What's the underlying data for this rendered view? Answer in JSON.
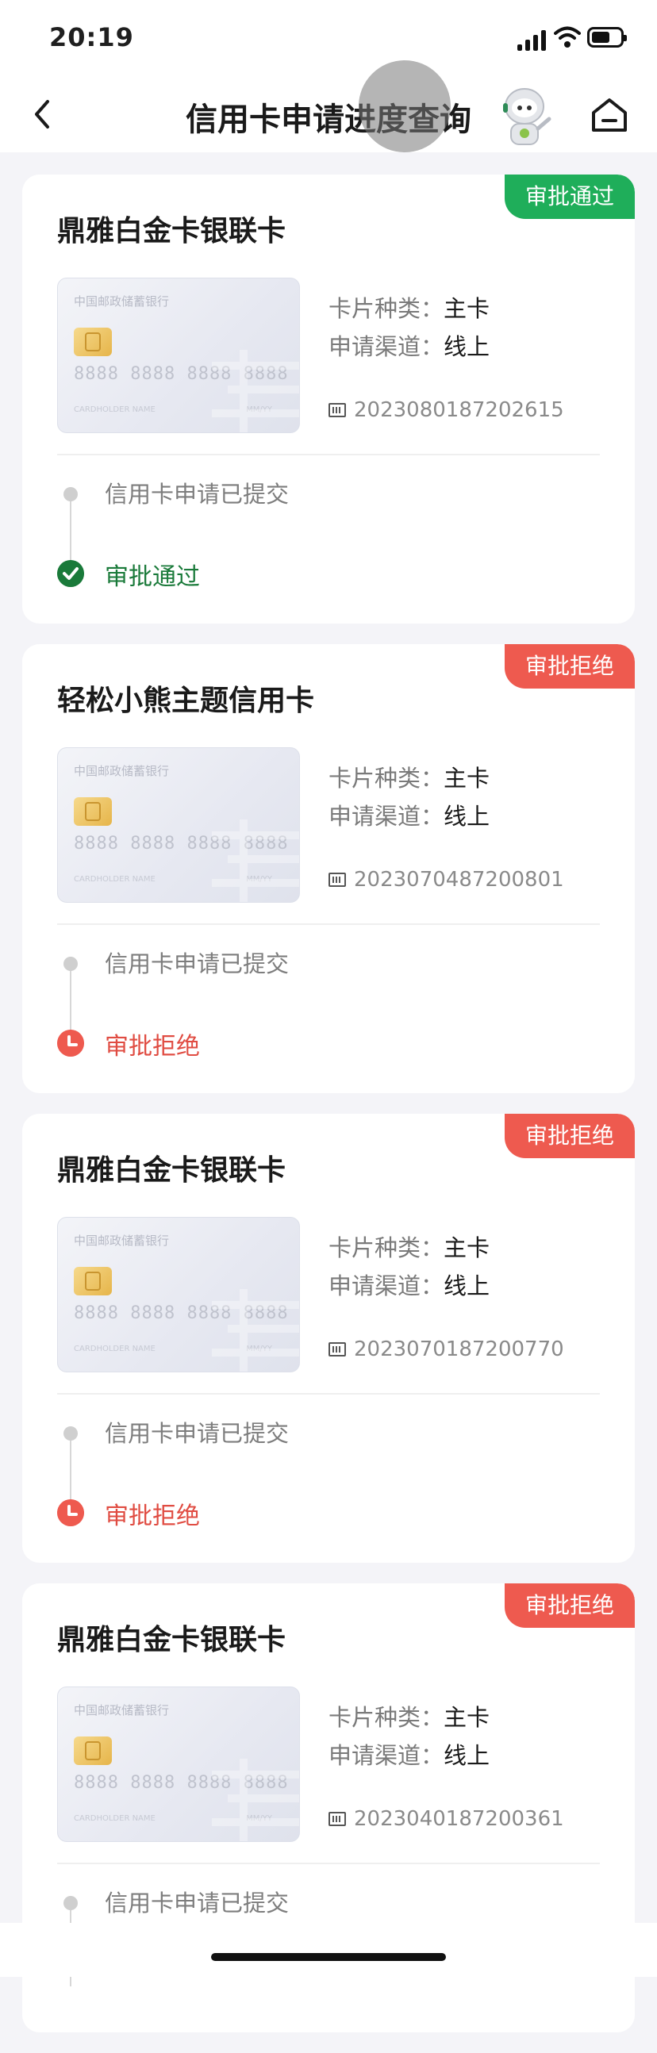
{
  "status_bar": {
    "time": "20:19"
  },
  "nav": {
    "title": "信用卡申请进度查询"
  },
  "labels": {
    "card_type_label": "卡片种类：",
    "channel_label": "申请渠道：",
    "step_submitted": "信用卡申请已提交"
  },
  "card_face": {
    "bank_name": "中国邮政储蓄银行",
    "number": "8888 8888 8888 8888",
    "holder": "CARDHOLDER NAME",
    "valid": "MM/YY"
  },
  "cards": [
    {
      "name": "鼎雅白金卡银联卡",
      "status": "审批通过",
      "status_type": "approved",
      "card_type": "主卡",
      "channel": "线上",
      "serial": "2023080187202615",
      "final_step": "审批通过"
    },
    {
      "name": "轻松小熊主题信用卡",
      "status": "审批拒绝",
      "status_type": "rejected",
      "card_type": "主卡",
      "channel": "线上",
      "serial": "2023070487200801",
      "final_step": "审批拒绝"
    },
    {
      "name": "鼎雅白金卡银联卡",
      "status": "审批拒绝",
      "status_type": "rejected",
      "card_type": "主卡",
      "channel": "线上",
      "serial": "2023070187200770",
      "final_step": "审批拒绝"
    },
    {
      "name": "鼎雅白金卡银联卡",
      "status": "审批拒绝",
      "status_type": "rejected",
      "card_type": "主卡",
      "channel": "线上",
      "serial": "2023040187200361",
      "final_step": ""
    }
  ],
  "colors": {
    "approved": "#1fae5a",
    "rejected": "#ee5a4f",
    "approved_text": "#1a7a3a"
  }
}
